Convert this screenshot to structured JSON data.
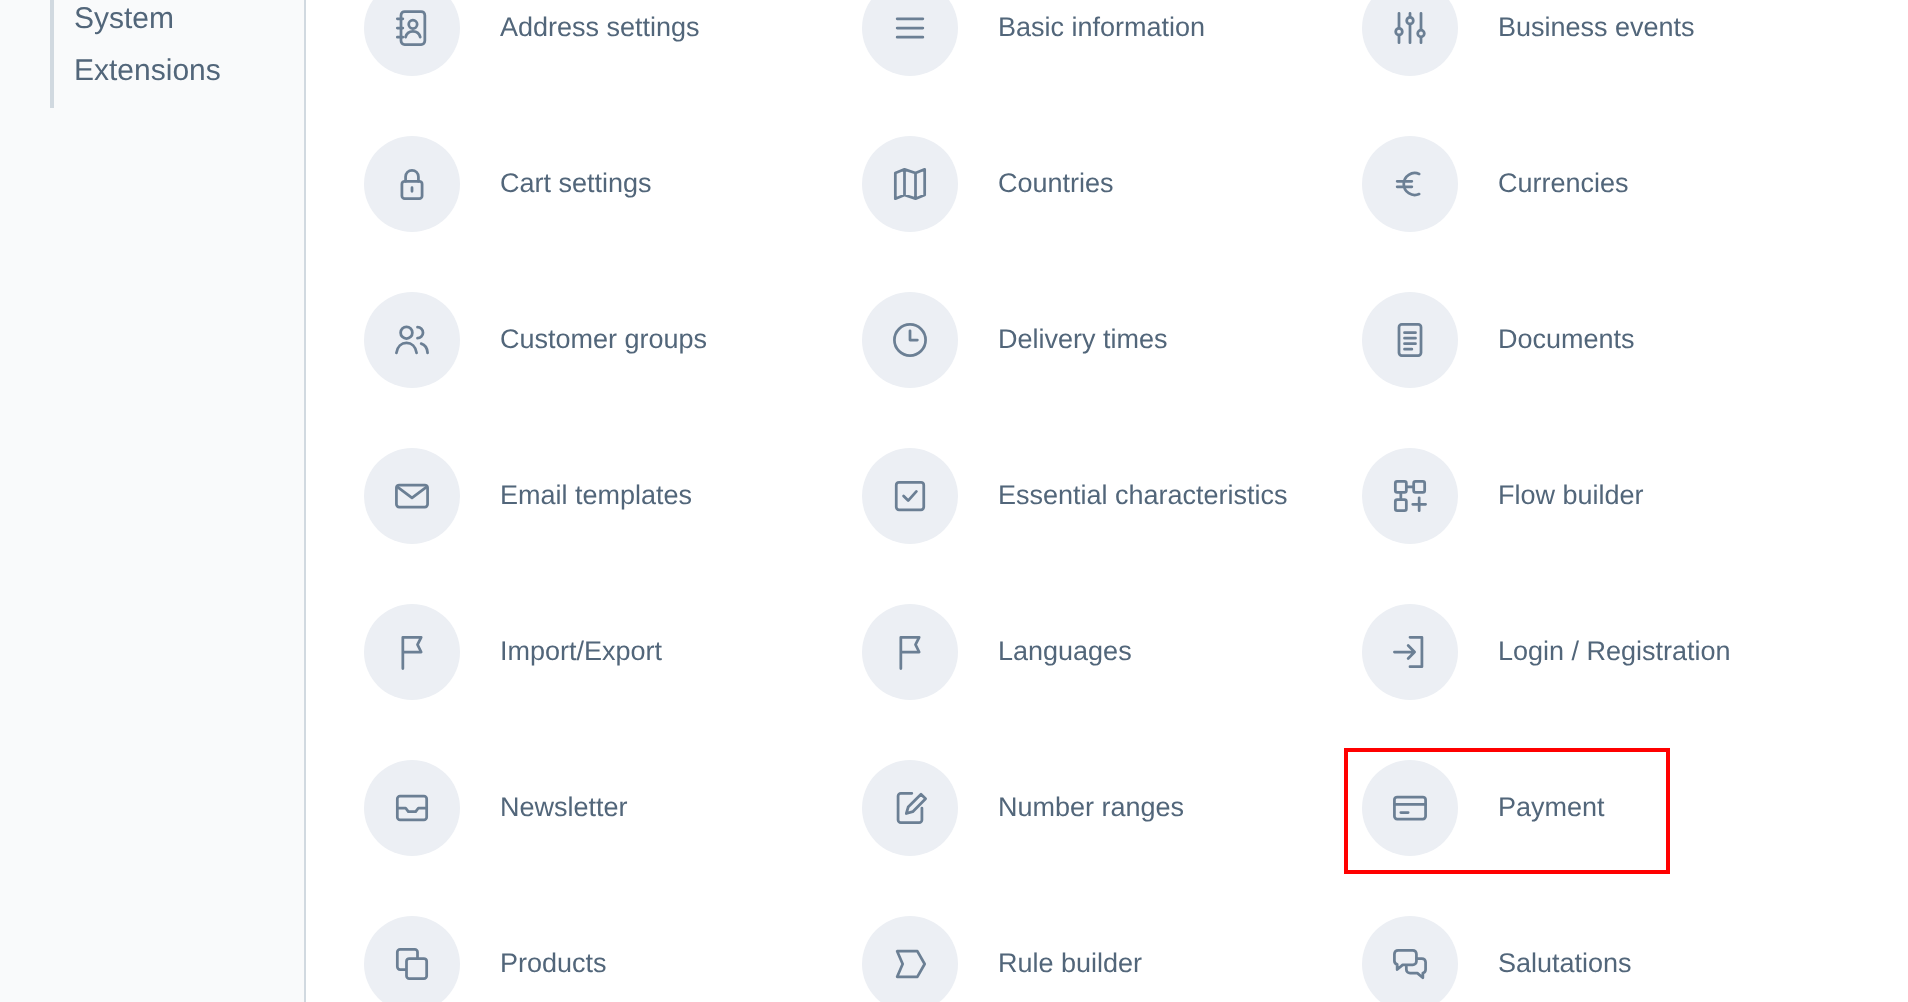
{
  "sidebar": {
    "items": [
      {
        "label": "System"
      },
      {
        "label": "Extensions"
      }
    ]
  },
  "settings": [
    {
      "label": "Address settings",
      "highlighted": false
    },
    {
      "label": "Basic information",
      "highlighted": false
    },
    {
      "label": "Business events",
      "highlighted": false
    },
    {
      "label": "Cart settings",
      "highlighted": false
    },
    {
      "label": "Countries",
      "highlighted": false
    },
    {
      "label": "Currencies",
      "highlighted": false
    },
    {
      "label": "Customer groups",
      "highlighted": false
    },
    {
      "label": "Delivery times",
      "highlighted": false
    },
    {
      "label": "Documents",
      "highlighted": false
    },
    {
      "label": "Email templates",
      "highlighted": false
    },
    {
      "label": "Essential characteristics",
      "highlighted": false
    },
    {
      "label": "Flow builder",
      "highlighted": false
    },
    {
      "label": "Import/Export",
      "highlighted": false
    },
    {
      "label": "Languages",
      "highlighted": false
    },
    {
      "label": "Login / Registration",
      "highlighted": false
    },
    {
      "label": "Newsletter",
      "highlighted": false
    },
    {
      "label": "Number ranges",
      "highlighted": false
    },
    {
      "label": "Payment",
      "highlighted": true
    },
    {
      "label": "Products",
      "highlighted": false
    },
    {
      "label": "Rule builder",
      "highlighted": false
    },
    {
      "label": "Salutations",
      "highlighted": false
    }
  ]
}
